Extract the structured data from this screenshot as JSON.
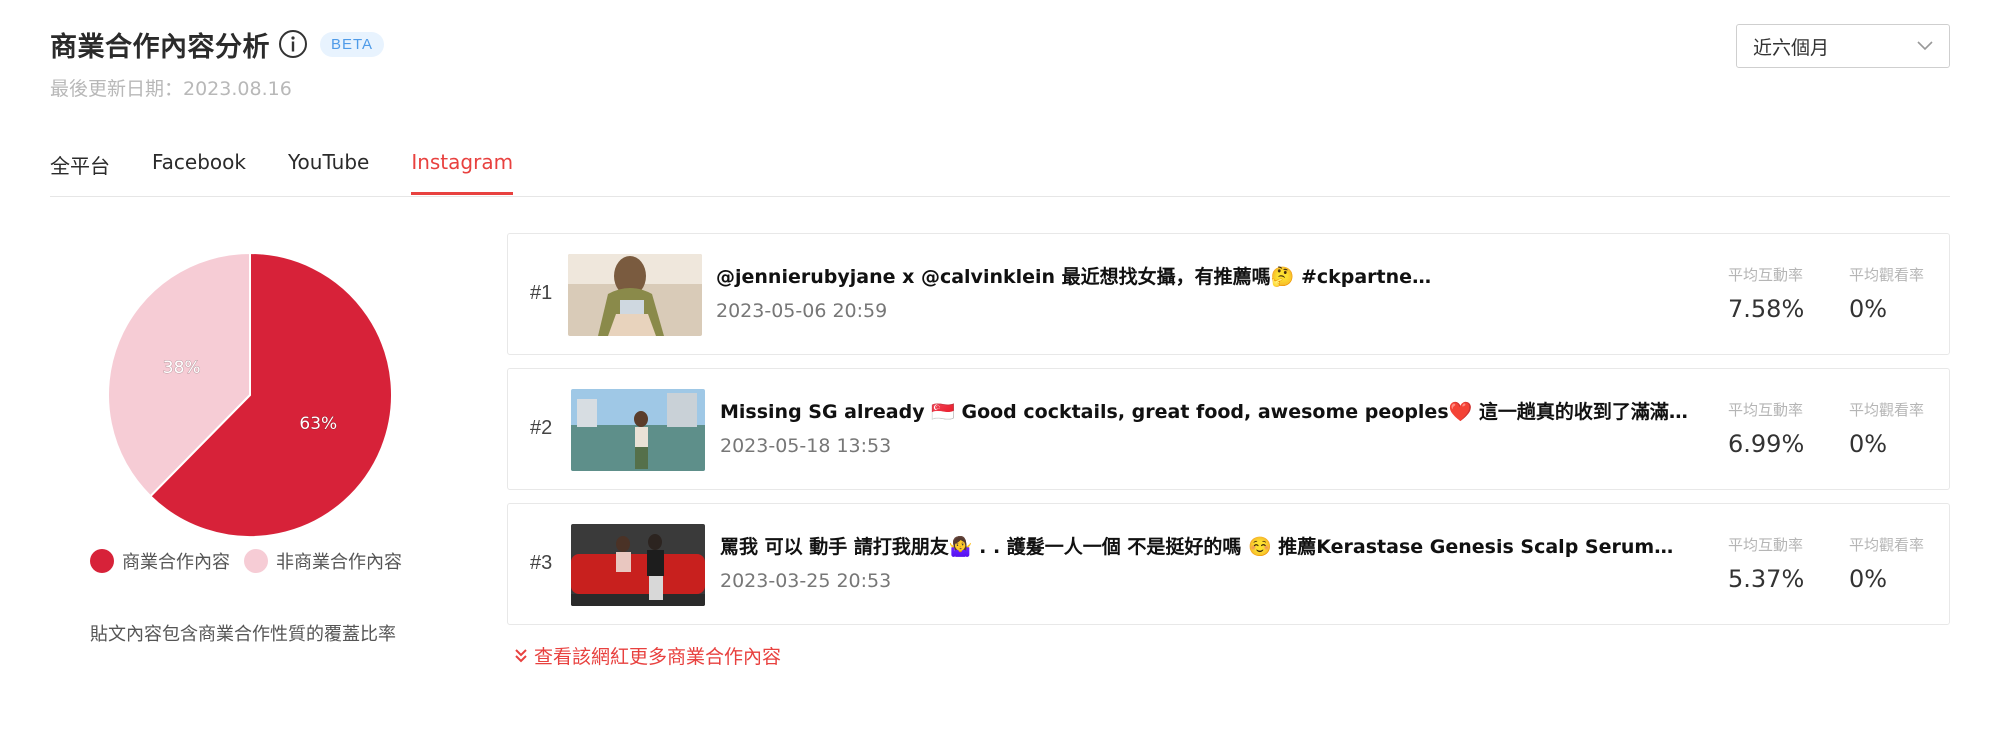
{
  "header": {
    "title": "商業合作內容分析",
    "beta_badge": "BETA",
    "updated": "最後更新日期：2023.08.16"
  },
  "period_select": {
    "value": "近六個月"
  },
  "tabs": [
    {
      "label": "全平台"
    },
    {
      "label": "Facebook"
    },
    {
      "label": "YouTube"
    },
    {
      "label": "Instagram",
      "active": true
    }
  ],
  "chart_data": {
    "type": "pie",
    "slices": [
      {
        "label": "商業合作內容",
        "value": 63,
        "display": "63%",
        "color": "#d72239"
      },
      {
        "label": "非商業合作內容",
        "value": 38,
        "display": "38%",
        "color": "#f6ccd5"
      }
    ],
    "caption": "貼文內容包含商業合作性質的覆蓋比率"
  },
  "posts": [
    {
      "rank": "#1",
      "text": "@jennierubyjane x @calvinklein 最近想找女攝，有推薦嗎🤔 #ckpartner #mycalvins",
      "date": "2023-05-06 20:59",
      "engagement_label": "平均互動率",
      "engagement_value": "7.58%",
      "view_label": "平均觀看率",
      "view_value": "0%"
    },
    {
      "rank": "#2",
      "text": "Missing SG already 🇸🇬 Good cocktails, great food, awesome peoples❤️ 這一趟真的收到了滿滿的幸福...",
      "date": "2023-05-18 13:53",
      "engagement_label": "平均互動率",
      "engagement_value": "6.99%",
      "view_label": "平均觀看率",
      "view_value": "0%"
    },
    {
      "rank": "#3",
      "text": "罵我 可以 動手 請打我朋友🤷‍♀️ . . 護髮一人一個 不是挺好的嗎 ☺️ 推薦Kerastase Genesis Scalp Serum。 ...",
      "date": "2023-03-25 20:53",
      "engagement_label": "平均互動率",
      "engagement_value": "5.37%",
      "view_label": "平均觀看率",
      "view_value": "0%"
    }
  ],
  "more_link": "查看該網紅更多商業合作內容",
  "icons": {
    "info": "info-icon",
    "dropdown": "chevron-down-icon",
    "more": "double-chevron-down-icon"
  },
  "colors": {
    "accent": "#e8413f",
    "beta_bg": "#e8f3fe",
    "beta_text": "#4f9be8"
  }
}
